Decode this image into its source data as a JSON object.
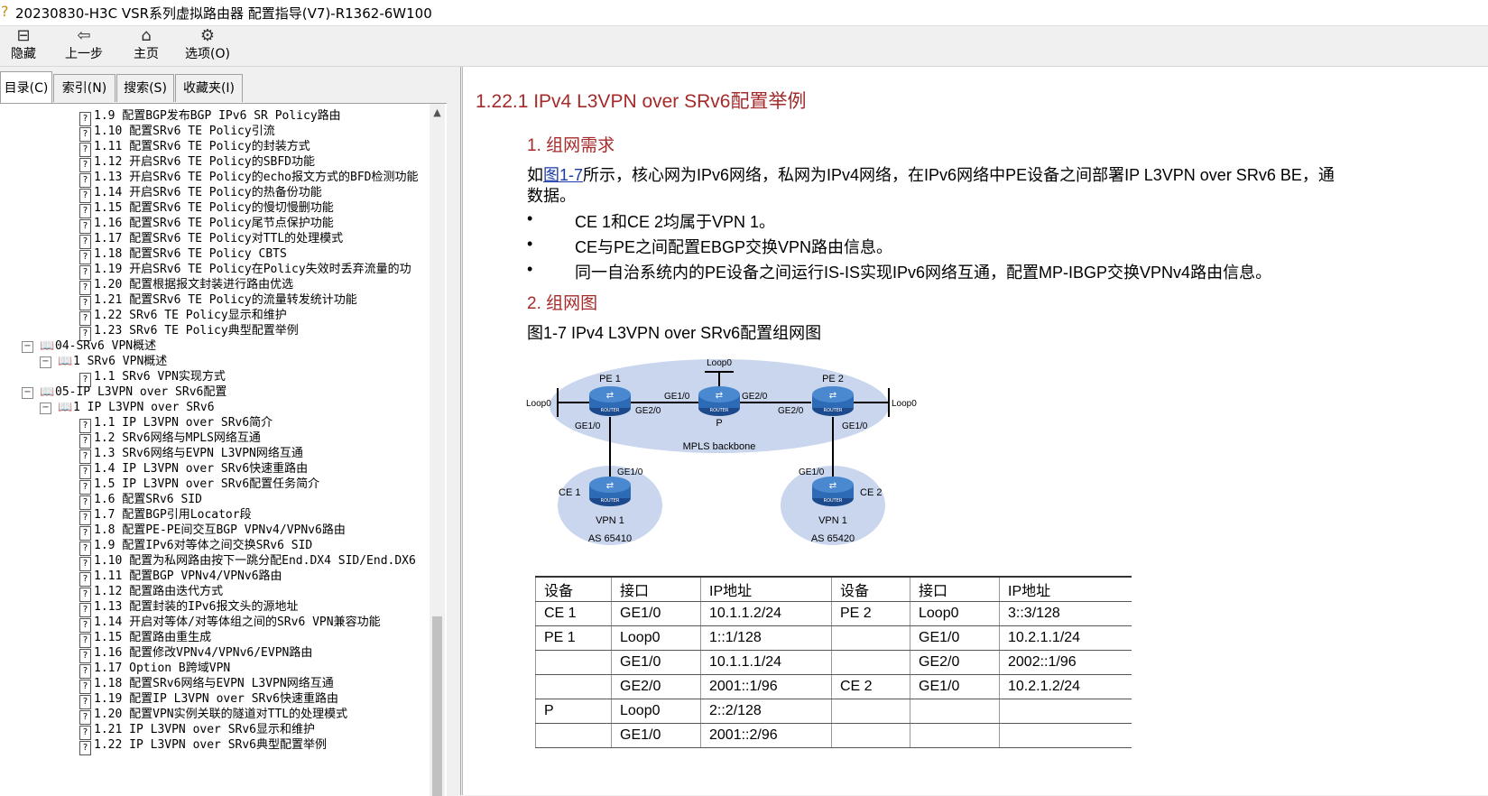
{
  "window": {
    "title": "20230830-H3C VSR系列虚拟路由器 配置指导(V7)-R1362-6W100"
  },
  "toolbar": {
    "hide": "隐藏",
    "back": "上一步",
    "home": "主页",
    "options": "选项(O)"
  },
  "tabs": [
    "目录(C)",
    "索引(N)",
    "搜索(S)",
    "收藏夹(I)"
  ],
  "tree": [
    "1.9  配置BGP发布BGP IPv6 SR Policy路由",
    "1.10  配置SRv6 TE Policy引流",
    "1.11  配置SRv6 TE Policy的封装方式",
    "1.12  开启SRv6 TE Policy的SBFD功能",
    "1.13  开启SRv6 TE Policy的echo报文方式的BFD检测功能",
    "1.14  开启SRv6 TE Policy的热备份功能",
    "1.15  配置SRv6 TE Policy的慢切慢删功能",
    "1.16  配置SRv6 TE Policy尾节点保护功能",
    "1.17  配置SRv6 TE Policy对TTL的处理模式",
    "1.18  配置SRv6 TE Policy CBTS",
    "1.19  开启SRv6 TE Policy在Policy失效时丢弃流量的功",
    "1.20  配置根据报文封装进行路由优选",
    "1.21  配置SRv6 TE Policy的流量转发统计功能",
    "1.22  SRv6 TE Policy显示和维护",
    "1.23  SRv6 TE Policy典型配置举例",
    "04-SRv6 VPN概述",
    "1 SRv6 VPN概述",
    "1.1  SRv6 VPN实现方式",
    "05-IP L3VPN over SRv6配置",
    "1 IP L3VPN over SRv6",
    "1.1  IP L3VPN over SRv6简介",
    "1.2  SRv6网络与MPLS网络互通",
    "1.3  SRv6网络与EVPN L3VPN网络互通",
    "1.4  IP L3VPN over SRv6快速重路由",
    "1.5  IP L3VPN over SRv6配置任务简介",
    "1.6  配置SRv6 SID",
    "1.7  配置BGP引用Locator段",
    "1.8  配置PE-PE间交互BGP VPNv4/VPNv6路由",
    "1.9  配置IPv6对等体之间交换SRv6 SID",
    "1.10  配置为私网路由按下一跳分配End.DX4 SID/End.DX6",
    "1.11  配置BGP VPNv4/VPNv6路由",
    "1.12  配置路由迭代方式",
    "1.13  配置封装的IPv6报文头的源地址",
    "1.14  开启对等体/对等体组之间的SRv6 VPN兼容功能",
    "1.15  配置路由重生成",
    "1.16  配置修改VPNv4/VPNv6/EVPN路由",
    "1.17  Option B跨域VPN",
    "1.18  配置SRv6网络与EVPN L3VPN网络互通",
    "1.19  配置IP L3VPN over SRv6快速重路由",
    "1.20  配置VPN实例关联的隧道对TTL的处理模式",
    "1.21  IP L3VPN over SRv6显示和维护",
    "1.22  IP L3VPN over SRv6典型配置举例"
  ],
  "content": {
    "section_title": "1.22.1  IPv4 L3VPN over SRv6配置举例",
    "h_requirements": "1. 组网需求",
    "intro_prefix": "如",
    "intro_link": "图1-7",
    "intro_rest": "所示，核心网为IPv6网络，私网为IPv4网络，在IPv6网络中PE设备之间部署IP L3VPN over SRv6 BE，通",
    "intro_line2": "数据。",
    "bullets": [
      "CE 1和CE 2均属于VPN 1。",
      "CE与PE之间配置EBGP交换VPN路由信息。",
      "同一自治系统内的PE设备之间运行IS-IS实现IPv6网络互通，配置MP-IBGP交换VPNv4路由信息。"
    ],
    "h_diagram": "2. 组网图",
    "figure_caption": "图1-7 IPv4 L3VPN over SRv6配置组网图"
  },
  "diagram": {
    "pe1": "PE 1",
    "pe2": "PE 2",
    "p": "P",
    "ce1": "CE 1",
    "ce2": "CE 2",
    "loop0": "Loop0",
    "ge1_0": "GE1/0",
    "ge2_0": "GE2/0",
    "backbone": "MPLS backbone",
    "vpn1": "VPN 1",
    "as1": "AS 65410",
    "as2": "AS 65420",
    "router": "ROUTER"
  },
  "table": {
    "headers": [
      "设备",
      "接口",
      "IP地址",
      "设备",
      "接口",
      "IP地址"
    ],
    "rows": [
      [
        "CE 1",
        "GE1/0",
        "10.1.1.2/24",
        "PE 2",
        "Loop0",
        "3::3/128"
      ],
      [
        "PE 1",
        "Loop0",
        "1::1/128",
        "",
        "GE1/0",
        "10.2.1.1/24"
      ],
      [
        "",
        "GE1/0",
        "10.1.1.1/24",
        "",
        "GE2/0",
        "2002::1/96"
      ],
      [
        "",
        "GE2/0",
        "2001::1/96",
        "CE 2",
        "GE1/0",
        "10.2.1.2/24"
      ],
      [
        "P",
        "Loop0",
        "2::2/128",
        "",
        "",
        ""
      ],
      [
        "",
        "GE1/0",
        "2001::2/96",
        "",
        "",
        ""
      ]
    ]
  }
}
